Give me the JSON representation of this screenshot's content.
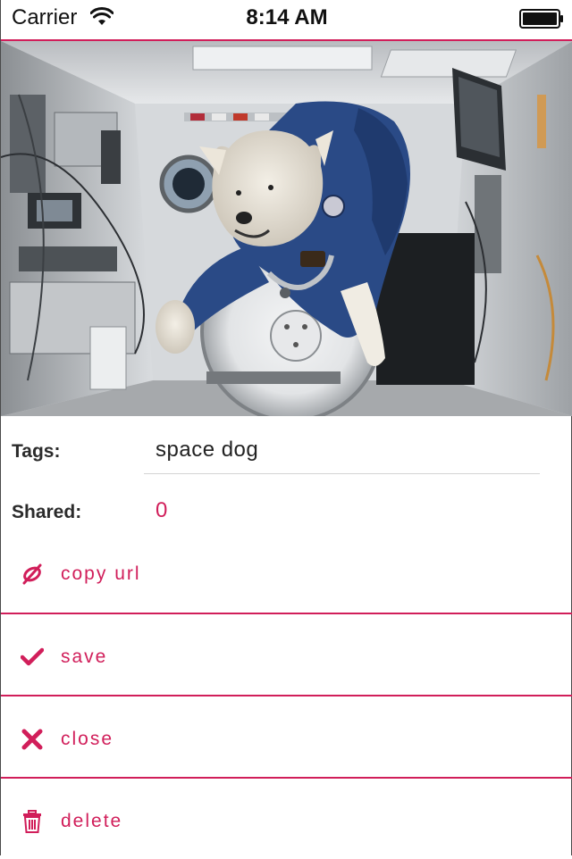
{
  "status_bar": {
    "carrier": "Carrier",
    "time": "8:14 AM",
    "wifi_icon": "wifi-icon",
    "battery_icon": "battery-full-icon"
  },
  "hero_image": {
    "description_icon": "photo-space-dog"
  },
  "details": {
    "tags_label": "Tags:",
    "tags_value": "space dog",
    "shared_label": "Shared:",
    "shared_value": "0"
  },
  "actions": [
    {
      "label": "copy url",
      "icon": "link-icon"
    },
    {
      "label": "save",
      "icon": "checkmark-icon"
    },
    {
      "label": "close",
      "icon": "close-icon"
    },
    {
      "label": "delete",
      "icon": "trash-icon"
    }
  ],
  "colors": {
    "accent": "#d11e5a",
    "text": "#222222",
    "divider": "#d4d4d4"
  }
}
